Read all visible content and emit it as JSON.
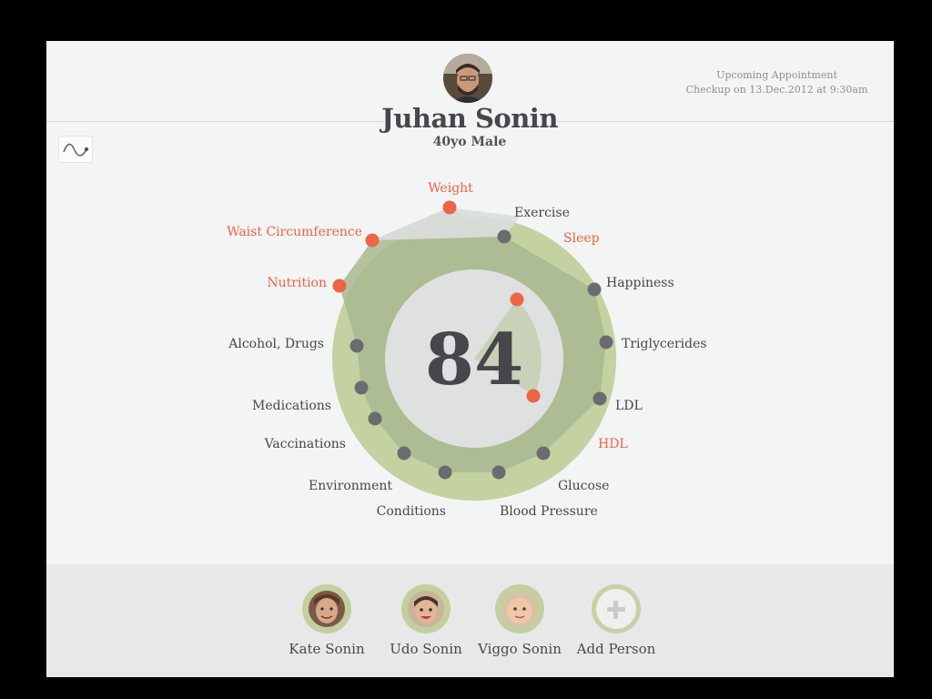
{
  "profile": {
    "name": "Juhan Sonin",
    "subtitle": "40yo Male",
    "avatar_icon": "avatar-photo"
  },
  "appointment": {
    "title": "Upcoming Appointment",
    "detail": "Checkup on 13.Dec.2012 at 9:30am"
  },
  "toolbar": {
    "trend_icon": "trend-line-icon"
  },
  "score": {
    "value": "84"
  },
  "colors": {
    "alert": "#ee6447",
    "normal": "#6b6c6f",
    "wheel": "#c4d2a2",
    "wheel_dark": "#a9b890"
  },
  "metrics": [
    {
      "label": "Weight",
      "status": "alert"
    },
    {
      "label": "Exercise",
      "status": "normal"
    },
    {
      "label": "Sleep",
      "status": "alert"
    },
    {
      "label": "Happiness",
      "status": "normal"
    },
    {
      "label": "Triglycerides",
      "status": "normal"
    },
    {
      "label": "LDL",
      "status": "normal"
    },
    {
      "label": "HDL",
      "status": "alert"
    },
    {
      "label": "Glucose",
      "status": "normal"
    },
    {
      "label": "Blood Pressure",
      "status": "normal"
    },
    {
      "label": "Conditions",
      "status": "normal"
    },
    {
      "label": "Environment",
      "status": "normal"
    },
    {
      "label": "Vaccinations",
      "status": "normal"
    },
    {
      "label": "Medications",
      "status": "normal"
    },
    {
      "label": "Alcohol, Drugs",
      "status": "normal"
    },
    {
      "label": "Nutrition",
      "status": "alert"
    },
    {
      "label": "Waist Circumference",
      "status": "alert"
    }
  ],
  "people": [
    {
      "name": "Kate Sonin"
    },
    {
      "name": "Udo Sonin"
    },
    {
      "name": "Viggo Sonin"
    }
  ],
  "add_person": {
    "label": "Add Person"
  }
}
